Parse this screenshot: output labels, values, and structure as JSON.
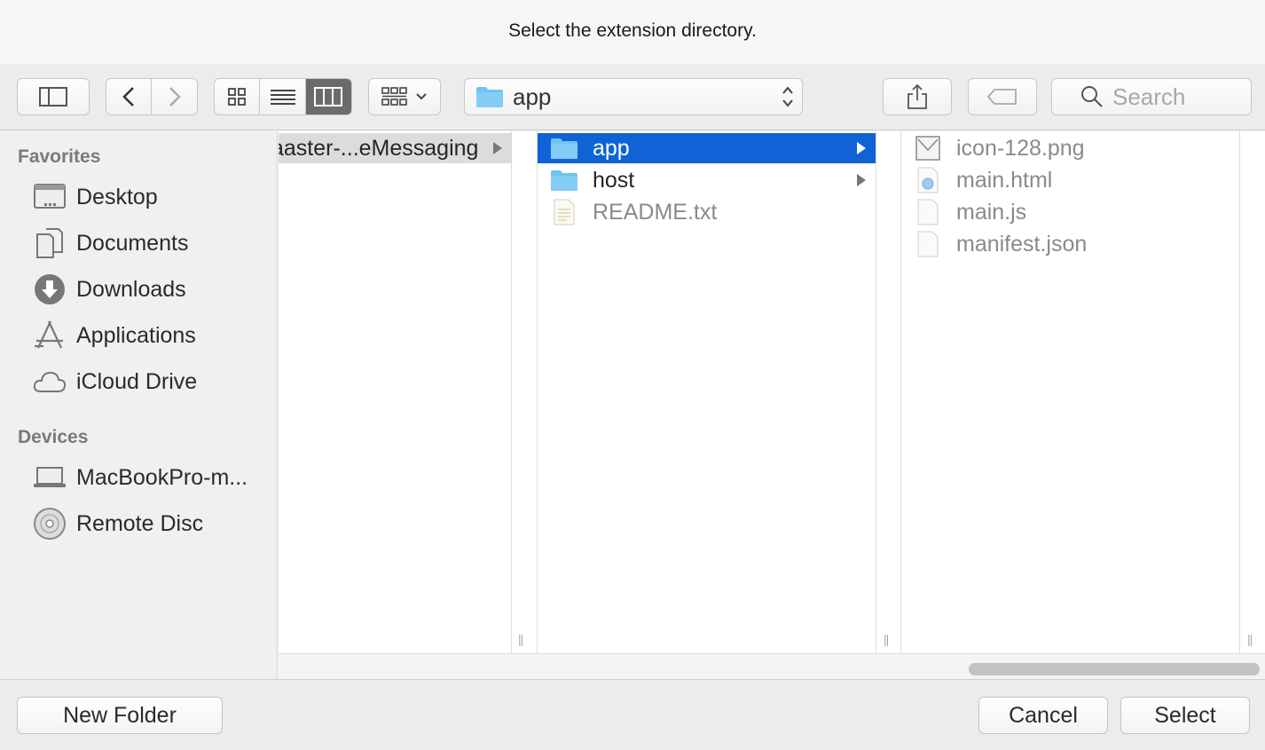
{
  "window": {
    "title": "Select the extension directory."
  },
  "toolbar": {
    "path_label": "app",
    "search_placeholder": "Search"
  },
  "sidebar": {
    "favorites_header": "Favorites",
    "favorites": [
      {
        "label": "Desktop",
        "icon": "desktop-icon"
      },
      {
        "label": "Documents",
        "icon": "documents-icon"
      },
      {
        "label": "Downloads",
        "icon": "downloads-icon"
      },
      {
        "label": "Applications",
        "icon": "applications-icon"
      },
      {
        "label": "iCloud Drive",
        "icon": "cloud-icon"
      }
    ],
    "devices_header": "Devices",
    "devices": [
      {
        "label": "MacBookPro-m...",
        "icon": "laptop-icon"
      },
      {
        "label": "Remote Disc",
        "icon": "disc-icon"
      }
    ]
  },
  "columns": {
    "col1": [
      {
        "label": "aaster-...eMessaging",
        "type": "folder",
        "has_children": true
      }
    ],
    "col2": [
      {
        "label": "app",
        "type": "folder",
        "has_children": true,
        "selected": true
      },
      {
        "label": "host",
        "type": "folder",
        "has_children": true
      },
      {
        "label": "README.txt",
        "type": "text-file",
        "dimmed": true
      }
    ],
    "col3": [
      {
        "label": "icon-128.png",
        "type": "image-file",
        "dimmed": true
      },
      {
        "label": "main.html",
        "type": "html-file",
        "dimmed": true
      },
      {
        "label": "main.js",
        "type": "file",
        "dimmed": true
      },
      {
        "label": "manifest.json",
        "type": "file",
        "dimmed": true
      }
    ]
  },
  "buttons": {
    "new_folder": "New Folder",
    "cancel": "Cancel",
    "select": "Select"
  },
  "colors": {
    "selection": "#1063d6",
    "folder": "#6ec3f4"
  }
}
